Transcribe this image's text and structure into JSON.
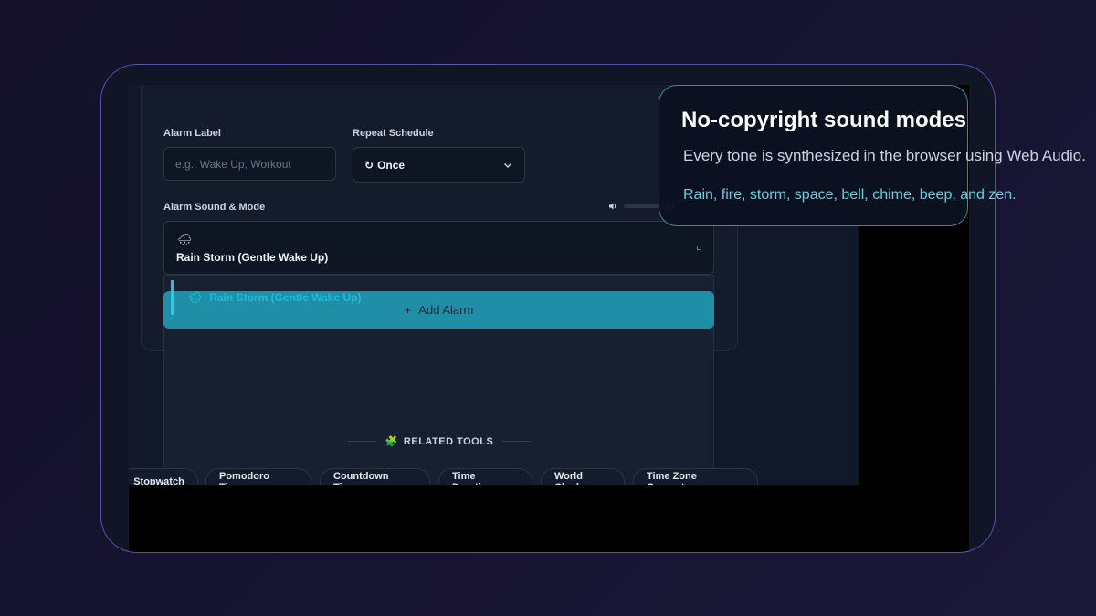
{
  "form": {
    "alarm_label": "Alarm Label",
    "alarm_label_placeholder": "e.g., Wake Up, Workout",
    "repeat_label": "Repeat Schedule",
    "repeat_icon": "↻",
    "repeat_value": "Once",
    "sound_label": "Alarm Sound & Mode",
    "sound_emoji": "🌧",
    "sound_value": "Rain Storm (Gentle Wake Up)",
    "volume_level": 0.85,
    "add_button": "Add Alarm",
    "add_icon": "+"
  },
  "dropdown": {
    "highlighted_emoji": "🌧",
    "highlighted": "Rain Storm (Gentle Wake Up)"
  },
  "related": {
    "icon": "🧩",
    "title": "RELATED TOOLS",
    "items": [
      "Stopwatch",
      "Pomodoro Timer",
      "Countdown Timer",
      "Time Duration",
      "World Clock",
      "Time Zone Converter"
    ]
  },
  "tooltip": {
    "title": "No-copyright sound modes",
    "body": "Every tone is synthesized in the browser using Web Audio.",
    "accent": "Rain, fire, storm, space, bell, chime, beep, and zen."
  },
  "colors": {
    "accent": "#22d3ee",
    "button": "#2198b2",
    "frame_border": "#5b4fb0"
  }
}
